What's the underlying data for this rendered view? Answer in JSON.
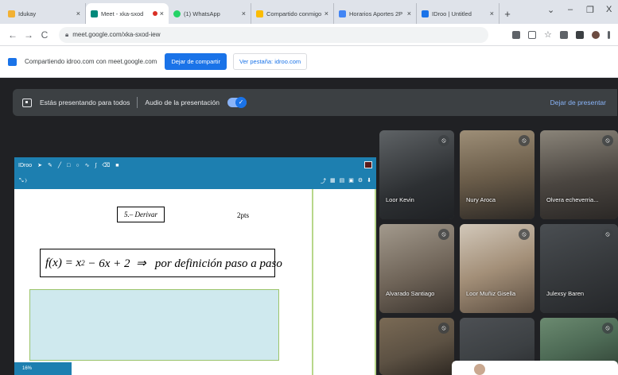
{
  "browser": {
    "tabs": [
      {
        "label": "Idukay",
        "favicon_color": "#f2b134",
        "active": false,
        "recording": false
      },
      {
        "label": "Meet - xka-sxod",
        "favicon_color": "#00897b",
        "active": true,
        "recording": true
      },
      {
        "label": "(1) WhatsApp",
        "favicon_color": "#25d366",
        "active": false,
        "recording": false
      },
      {
        "label": "Compartido conmigo",
        "favicon_color": "#fbbc04",
        "active": false,
        "recording": false
      },
      {
        "label": "Horarios Aportes 2P",
        "favicon_color": "#4285f4",
        "active": false,
        "recording": false
      },
      {
        "label": "IDroo | Untitled",
        "favicon_color": "#1a73e8",
        "active": false,
        "recording": false
      }
    ],
    "new_tab_symbol": "+",
    "window_controls": {
      "chevron": "⌄",
      "minimize": "–",
      "maximize": "❐",
      "close": "X"
    },
    "nav": {
      "back": "←",
      "forward": "→",
      "reload": "C"
    },
    "url": "meet.google.com/xka-sxod-iew",
    "extension_icons": [
      "cast-icon",
      "share-icon",
      "star-icon",
      "extension-icon",
      "puzzle-icon",
      "profile-icon",
      "menu-icon"
    ]
  },
  "sharebar": {
    "text": "Compartiendo idroo.com con meet.google.com",
    "stop_button": "Dejar de compartir",
    "see_button": "Ver pestaña: idroo.com"
  },
  "meet": {
    "presenting_text": "Estás presentando para todos",
    "audio_text": "Audio de la presentación",
    "audio_toggle_on": true,
    "stop_presenting": "Dejar de presentar"
  },
  "whiteboard": {
    "brand": "IDroo",
    "task_label": "5.– Derivar",
    "points": "2pts",
    "formula_lhs": "f(x) = x",
    "formula_exp": "2",
    "formula_rhs": " − 6x + 2  ⇒   por definición paso a paso",
    "zoom": "16%",
    "colors": {
      "toolbar": "#1d7fb0",
      "answer_fill": "#cfe9ee",
      "border_green": "#9bc46a"
    }
  },
  "participants": [
    {
      "name": "Loor Kevin",
      "color": "#4a4f52"
    },
    {
      "name": "Nury Aroca",
      "color": "#7a6e5c"
    },
    {
      "name": "Olvera echeverria...",
      "color": "#5e5a55"
    },
    {
      "name": "Alvarado Santiago",
      "color": "#6d6a60"
    },
    {
      "name": "Loor Muñiz Gisella",
      "color": "#8a7f72"
    },
    {
      "name": "Julexsy Baren",
      "color": "#3c4043"
    },
    {
      "name": "",
      "color": "#5c5143"
    },
    {
      "name": "",
      "color": "#3c4043"
    },
    {
      "name": "",
      "color": "#4d6a55"
    }
  ]
}
